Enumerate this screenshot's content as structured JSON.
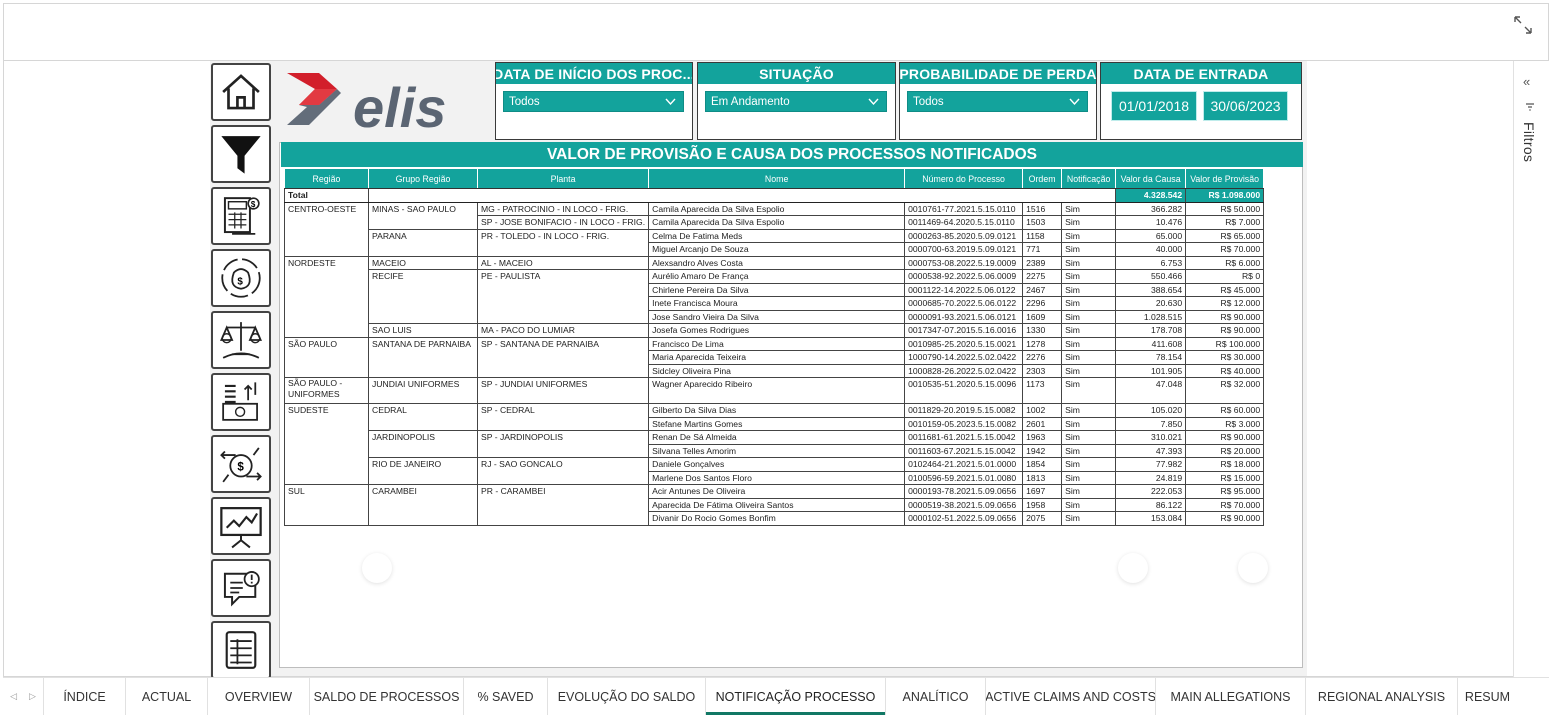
{
  "colors": {
    "teal": "#13a39c",
    "logo_red": "#d21f2b",
    "logo_gray": "#5b6573",
    "tab_active": "#117865"
  },
  "nav_icons": [
    "home-icon",
    "filter-funnel-icon",
    "calculator-money-icon",
    "money-bag-cycle-icon",
    "scale-money-icon",
    "cash-stack-chart-icon",
    "money-exchange-icon",
    "presentation-chart-icon",
    "alert-document-icon",
    "table-grid-icon"
  ],
  "logo": {
    "text": "elis"
  },
  "slicers": {
    "data_inicio": {
      "title": "DATA DE INÍCIO DOS PROC...",
      "value": "Todos"
    },
    "situacao": {
      "title": "SITUAÇÃO",
      "value": "Em Andamento"
    },
    "probabilidade": {
      "title": "PROBABILIDADE DE PERDA",
      "value": "Todos"
    },
    "data_entrada": {
      "title": "DATA DE ENTRADA",
      "start": "01/01/2018",
      "end": "30/06/2023"
    }
  },
  "table": {
    "title": "VALOR DE PROVISÃO E CAUSA DOS PROCESSOS NOTIFICADOS",
    "headers": [
      "Região",
      "Grupo Região",
      "Planta",
      "Nome",
      "Número do Processo",
      "Ordem",
      "Notificação",
      "Valor da Causa",
      "Valor de Provisão"
    ],
    "total": {
      "label": "Total",
      "valor_causa": "4.328.542",
      "valor_provisao": "R$ 1.098.000"
    },
    "rows": [
      [
        "CENTRO-OESTE",
        "MINAS - SAO PAULO",
        "MG - PATROCINIO - IN LOCO - FRIG.",
        "Camila Aparecida Da Silva Espolio",
        "0010761-77.2021.5.15.0110",
        "1516",
        "Sim",
        "366.282",
        "R$ 50.000"
      ],
      [
        "",
        "",
        "SP - JOSE BONIFACIO - IN LOCO - FRIG.",
        "Camila Aparecida Da Silva Espolio",
        "0011469-64.2020.5.15.0110",
        "1503",
        "Sim",
        "10.476",
        "R$ 7.000"
      ],
      [
        "",
        "PARANA",
        "PR - TOLEDO - IN LOCO - FRIG.",
        "Celma De Fatima Meds",
        "0000263-85.2020.5.09.0121",
        "1158",
        "Sim",
        "65.000",
        "R$ 65.000"
      ],
      [
        "",
        "",
        "",
        "Miguel Arcanjo De Souza",
        "0000700-63.2019.5.09.0121",
        "771",
        "Sim",
        "40.000",
        "R$ 70.000"
      ],
      [
        "NORDESTE",
        "MACEIO",
        "AL - MACEIO",
        "Alexsandro Alves Costa",
        "0000753-08.2022.5.19.0009",
        "2389",
        "Sim",
        "6.753",
        "R$ 6.000"
      ],
      [
        "",
        "RECIFE",
        "PE - PAULISTA",
        "Aurélio Amaro De França",
        "0000538-92.2022.5.06.0009",
        "2275",
        "Sim",
        "550.466",
        "R$ 0"
      ],
      [
        "",
        "",
        "",
        "Chirlene Pereira Da Silva",
        "0001122-14.2022.5.06.0122",
        "2467",
        "Sim",
        "388.654",
        "R$ 45.000"
      ],
      [
        "",
        "",
        "",
        "Inete Francisca Moura",
        "0000685-70.2022.5.06.0122",
        "2296",
        "Sim",
        "20.630",
        "R$ 12.000"
      ],
      [
        "",
        "",
        "",
        "Jose Sandro Vieira Da Silva",
        "0000091-93.2021.5.06.0121",
        "1609",
        "Sim",
        "1.028.515",
        "R$ 90.000"
      ],
      [
        "",
        "SAO LUIS",
        "MA - PACO DO LUMIAR",
        "Josefa Gomes Rodrigues",
        "0017347-07.2015.5.16.0016",
        "1330",
        "Sim",
        "178.708",
        "R$ 90.000"
      ],
      [
        "SÃO PAULO",
        "SANTANA DE PARNAIBA",
        "SP - SANTANA DE PARNAIBA",
        "Francisco De Lima",
        "0010985-25.2020.5.15.0021",
        "1278",
        "Sim",
        "411.608",
        "R$ 100.000"
      ],
      [
        "",
        "",
        "",
        "Maria Aparecida Teixeira",
        "1000790-14.2022.5.02.0422",
        "2276",
        "Sim",
        "78.154",
        "R$ 30.000"
      ],
      [
        "",
        "",
        "",
        "Sidcley Oliveira Pina",
        "1000828-26.2022.5.02.0422",
        "2303",
        "Sim",
        "101.905",
        "R$ 40.000"
      ],
      [
        "SÃO PAULO - UNIFORMES",
        "JUNDIAI UNIFORMES",
        "SP - JUNDIAI UNIFORMES",
        "Wagner Aparecido Ribeiro",
        "0010535-51.2020.5.15.0096",
        "1173",
        "Sim",
        "47.048",
        "R$ 32.000"
      ],
      [
        "SUDESTE",
        "CEDRAL",
        "SP - CEDRAL",
        "Gilberto Da Silva Dias",
        "0011829-20.2019.5.15.0082",
        "1002",
        "Sim",
        "105.020",
        "R$ 60.000"
      ],
      [
        "",
        "",
        "",
        "Stefane Martins Gomes",
        "0010159-05.2023.5.15.0082",
        "2601",
        "Sim",
        "7.850",
        "R$ 3.000"
      ],
      [
        "",
        "JARDINOPOLIS",
        "SP - JARDINOPOLIS",
        "Renan De Sá Almeida",
        "0011681-61.2021.5.15.0042",
        "1963",
        "Sim",
        "310.021",
        "R$ 90.000"
      ],
      [
        "",
        "",
        "",
        "Silvana Telles Amorim",
        "0011603-67.2021.5.15.0042",
        "1942",
        "Sim",
        "47.393",
        "R$ 20.000"
      ],
      [
        "",
        "RIO DE JANEIRO",
        "RJ - SAO GONCALO",
        "Daniele Gonçalves",
        "0102464-21.2021.5.01.0000",
        "1854",
        "Sim",
        "77.982",
        "R$ 18.000"
      ],
      [
        "",
        "",
        "",
        "Marlene Dos Santos Floro",
        "0100596-59.2021.5.01.0080",
        "1813",
        "Sim",
        "24.819",
        "R$ 15.000"
      ],
      [
        "SUL",
        "CARAMBEI",
        "PR - CARAMBEI",
        "Acir Antunes De Oliveira",
        "0000193-78.2021.5.09.0656",
        "1697",
        "Sim",
        "222.053",
        "R$ 95.000"
      ],
      [
        "",
        "",
        "",
        "Aparecida De Fátima Oliveira Santos",
        "0000519-38.2021.5.09.0656",
        "1958",
        "Sim",
        "86.122",
        "R$ 70.000"
      ],
      [
        "",
        "",
        "",
        "Divanir Do Rocio Gomes Bonfim",
        "0000102-51.2022.5.09.0656",
        "2075",
        "Sim",
        "153.084",
        "R$ 90.000"
      ]
    ]
  },
  "filters_pane": {
    "label": "Filtros",
    "collapse": "«"
  },
  "tabs": [
    "ÍNDICE",
    "ACTUAL",
    "OVERVIEW",
    "SALDO DE PROCESSOS",
    "% SAVED",
    "EVOLUÇÃO DO SALDO",
    "NOTIFICAÇÃO PROCESSO",
    "ANALÍTICO",
    "ACTIVE CLAIMS AND COSTS",
    "MAIN ALLEGATIONS",
    "REGIONAL ANALYSIS",
    "RESUM"
  ],
  "active_tab": "NOTIFICAÇÃO PROCESSO"
}
